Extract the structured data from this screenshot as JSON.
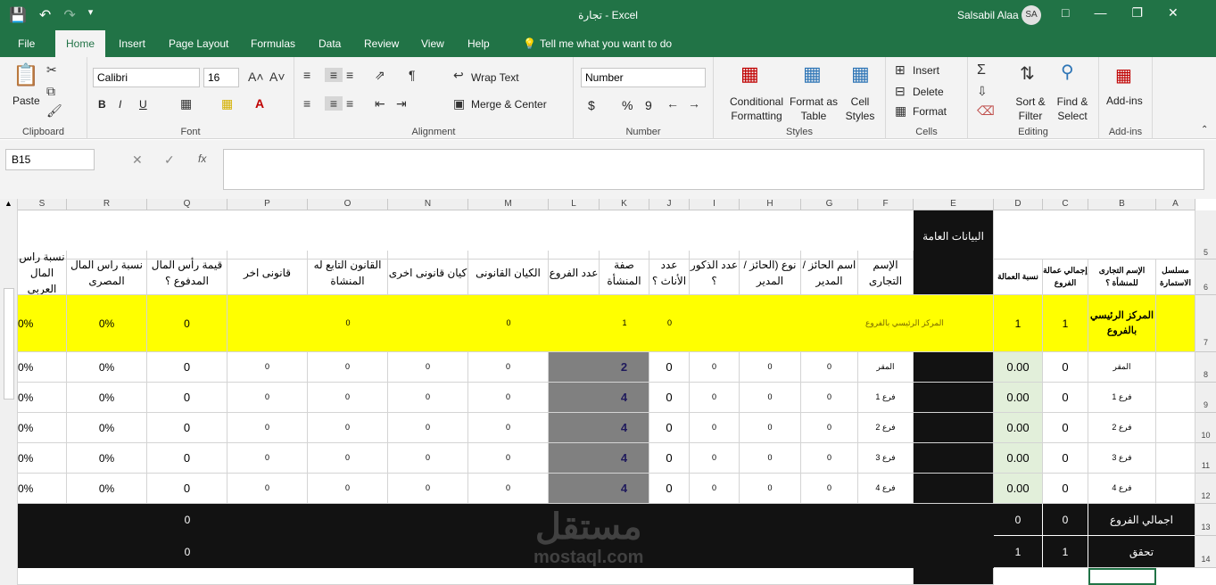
{
  "window": {
    "title": "تجارة  -  Excel",
    "user": "Salsabil Alaa",
    "avatar": "SA"
  },
  "ribbon_tabs": [
    "File",
    "Home",
    "Insert",
    "Page Layout",
    "Formulas",
    "Data",
    "Review",
    "View",
    "Help",
    "Tell me what you want to do"
  ],
  "ribbon": {
    "clipboard": {
      "paste": "Paste",
      "label": "Clipboard"
    },
    "font": {
      "name": "Calibri",
      "size": "16",
      "label": "Font",
      "bold": "B",
      "italic": "I",
      "underline": "U"
    },
    "alignment": {
      "wrap": "Wrap Text",
      "merge": "Merge & Center",
      "label": "Alignment"
    },
    "number": {
      "format": "Number",
      "currency": "$",
      "percent": "%",
      "comma": "9",
      "label": "Number"
    },
    "styles": {
      "cond": "Conditional Formatting",
      "table": "Format as Table",
      "cell": "Cell Styles",
      "label": "Styles"
    },
    "cells": {
      "insert": "Insert",
      "delete": "Delete",
      "format": "Format",
      "label": "Cells"
    },
    "editing": {
      "sort": "Sort & Filter",
      "find": "Find & Select",
      "label": "Editing"
    },
    "addins": {
      "btn": "Add-ins",
      "label": "Add-ins"
    }
  },
  "formula_bar": {
    "namebox": "B15",
    "fx": "fx",
    "value": ""
  },
  "columns": [
    "S",
    "R",
    "Q",
    "P",
    "O",
    "N",
    "M",
    "L",
    "K",
    "J",
    "I",
    "H",
    "G",
    "F",
    "E",
    "D",
    "C",
    "B",
    "A"
  ],
  "rows": [
    "5",
    "6",
    "7",
    "8",
    "9",
    "10",
    "11",
    "12",
    "13",
    "14"
  ],
  "sheet": {
    "e5": "البيانات العامة",
    "headers": {
      "S": "نسبة راس المال العربي",
      "R": "نسبة راس المال المصرى",
      "Q": "قيمة رأس المال المدفوع ؟",
      "P": "قانونى اخر",
      "O": "القانون التابع له المنشاة",
      "N": "كيان قانونى اخرى",
      "M": "الكيان القانونى",
      "L": "عدد الفروع",
      "K": "صفة المنشأة",
      "J": "عدد الأناث ؟",
      "I": "عدد الذكور ؟",
      "H": "نوع (الحائز / المدير",
      "G": "اسم الحائز / المدير",
      "F": "الإسم التجارى",
      "D": "نسبة العمالة",
      "C": "إجمالي عمالة الفروع",
      "B": "الإسم التجارى للمنشأة ؟",
      "A": "مسلسل الاستمارة"
    },
    "row7": {
      "S": "0%",
      "R": "0%",
      "Q": "0",
      "O": "0",
      "M": "0",
      "K": "1",
      "J": "0",
      "F": "المركز الرئيسي بالفروع",
      "D": "1",
      "C": "1",
      "B": "المركز الرئيسي بالفروع"
    },
    "branches": [
      {
        "S": "0%",
        "R": "0%",
        "Q": "0",
        "P": "0",
        "O": "0",
        "N": "0",
        "M": "0",
        "K": "2",
        "J": "0",
        "I": "0",
        "H": "0",
        "G": "0",
        "F": "المقر",
        "D": "0.00",
        "C": "0",
        "B": "المقر"
      },
      {
        "S": "0%",
        "R": "0%",
        "Q": "0",
        "P": "0",
        "O": "0",
        "N": "0",
        "M": "0",
        "K": "4",
        "J": "0",
        "I": "0",
        "H": "0",
        "G": "0",
        "F": "فرع 1",
        "D": "0.00",
        "C": "0",
        "B": "فرع 1"
      },
      {
        "S": "0%",
        "R": "0%",
        "Q": "0",
        "P": "0",
        "O": "0",
        "N": "0",
        "M": "0",
        "K": "4",
        "J": "0",
        "I": "0",
        "H": "0",
        "G": "0",
        "F": "فرع 2",
        "D": "0.00",
        "C": "0",
        "B": "فرع 2"
      },
      {
        "S": "0%",
        "R": "0%",
        "Q": "0",
        "P": "0",
        "O": "0",
        "N": "0",
        "M": "0",
        "K": "4",
        "J": "0",
        "I": "0",
        "H": "0",
        "G": "0",
        "F": "فرع 3",
        "D": "0.00",
        "C": "0",
        "B": "فرع 3"
      },
      {
        "S": "0%",
        "R": "0%",
        "Q": "0",
        "P": "0",
        "O": "0",
        "N": "0",
        "M": "0",
        "K": "4",
        "J": "0",
        "I": "0",
        "H": "0",
        "G": "0",
        "F": "فرع 4",
        "D": "0.00",
        "C": "0",
        "B": "فرع 4"
      }
    ],
    "row13": {
      "Q": "0",
      "D": "0",
      "C": "0",
      "B": "اجمالي الفروع"
    },
    "row14": {
      "Q": "0",
      "D": "1",
      "C": "1",
      "B": "تحقق"
    }
  },
  "watermark": {
    "ar": "مستقل",
    "en": "mostaql.com"
  },
  "colors": {
    "excel_green": "#217346",
    "yellow": "#ffff00",
    "black": "#121212",
    "grey": "#808080",
    "light_green": "#e2efda"
  }
}
